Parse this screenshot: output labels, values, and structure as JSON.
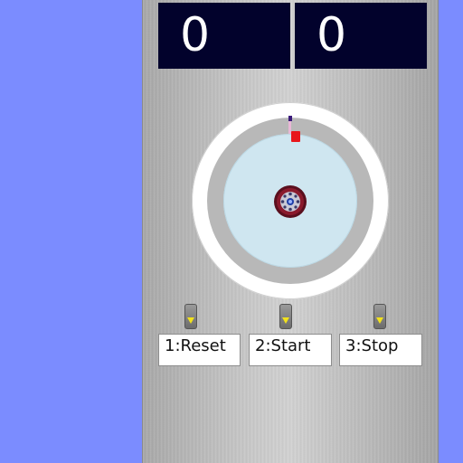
{
  "counters": {
    "left_value": "0",
    "right_value": "0"
  },
  "controls": {
    "buttons": [
      {
        "label": "1:Reset",
        "icon": "indicator-arrow-icon"
      },
      {
        "label": "2:Start",
        "icon": "indicator-arrow-icon"
      },
      {
        "label": "3:Stop",
        "icon": "indicator-arrow-icon"
      }
    ]
  },
  "colors": {
    "background": "#7b8cff",
    "counter_bg": "#02022c",
    "counter_text": "#ffffff",
    "dial_plate": "#cfe6f0",
    "marker": "#e8161b",
    "indicator_arrow": "#f2e21b"
  }
}
